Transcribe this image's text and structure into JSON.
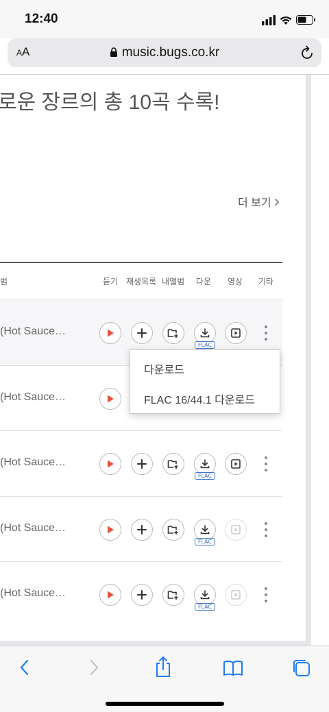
{
  "status": {
    "time": "12:40"
  },
  "browser": {
    "text_size_label": "AA",
    "url": "music.bugs.co.kr"
  },
  "page": {
    "headline": "로운 장르의 총 10곡 수록!",
    "more_link": "더 보기",
    "columns": {
      "album": "범",
      "listen": "듣기",
      "playlist": "재생목록",
      "my_album": "내앨범",
      "download": "다운",
      "video": "영상",
      "etc": "기타"
    },
    "flac_badge": "FLAC",
    "rows": [
      {
        "title": "(Hot Sauce…",
        "video_enabled": true
      },
      {
        "title": "(Hot Sauce…",
        "video_enabled": true
      },
      {
        "title": "(Hot Sauce…",
        "video_enabled": true
      },
      {
        "title": "(Hot Sauce…",
        "video_enabled": false
      },
      {
        "title": "(Hot Sauce…",
        "video_enabled": false
      }
    ],
    "download_menu": {
      "items": [
        "다운로드",
        "FLAC 16/44.1 다운로드"
      ]
    }
  },
  "colors": {
    "accent_play": "#e8503a",
    "flac_blue": "#3b73c7",
    "ios_blue": "#1f7cf6"
  }
}
